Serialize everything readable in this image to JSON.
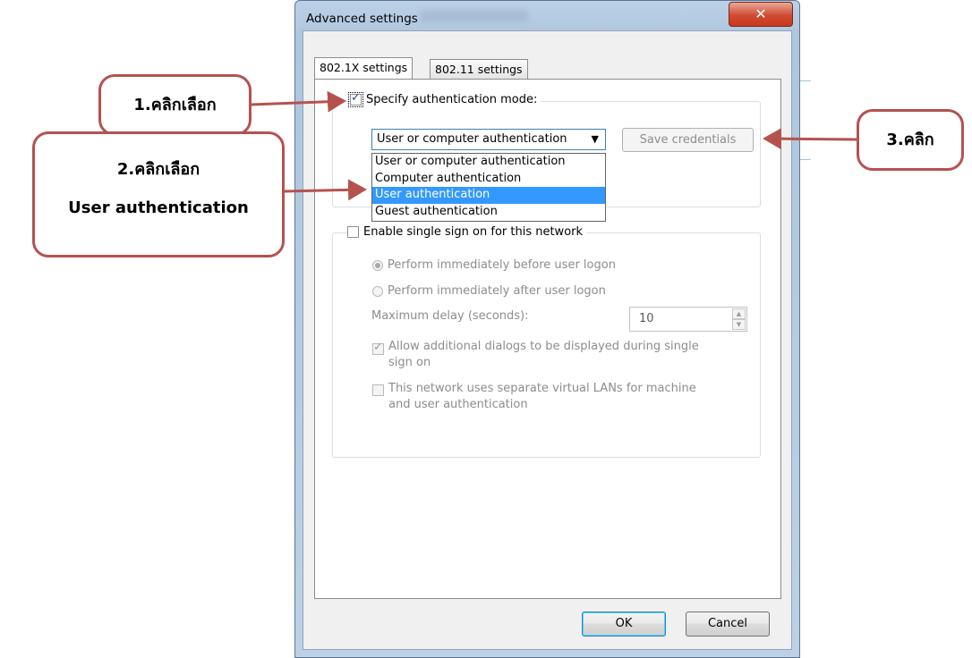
{
  "window": {
    "title": "Advanced settings",
    "close_glyph": "✕"
  },
  "tabs": [
    {
      "label": "802.1X settings",
      "active": true
    },
    {
      "label": "802.11 settings",
      "active": false
    }
  ],
  "auth_group": {
    "checkbox_label": "Specify authentication mode:",
    "checked": true,
    "combo_value": "User or computer authentication",
    "combo_arrow": "▼",
    "options": [
      "User or computer authentication",
      "Computer authentication",
      "User authentication",
      "Guest authentication"
    ],
    "highlighted_option": "User authentication",
    "save_button": "Save credentials"
  },
  "sso_group": {
    "checkbox_label": "Enable single sign on for this network",
    "checked": false,
    "radio_before": "Perform immediately before user logon",
    "radio_after": "Perform immediately after user logon",
    "max_delay_label": "Maximum delay (seconds):",
    "max_delay_value": "10",
    "spin_up": "▲",
    "spin_down": "▼",
    "allow_dialogs_line1": "Allow additional dialogs to be displayed during single",
    "allow_dialogs_line2": "sign on",
    "vlan_line1": "This network uses separate virtual LANs for machine",
    "vlan_line2": "and user authentication"
  },
  "footer": {
    "ok": "OK",
    "cancel": "Cancel"
  },
  "callouts": {
    "step1": "1.คลิกเลือก",
    "step2_line1": "2.คลิกเลือก",
    "step2_line2": "User authentication",
    "step3": "3.คลิก"
  },
  "colors": {
    "callout_border": "#b5524f",
    "selection": "#3399ff",
    "close_button": "#c9371e"
  }
}
